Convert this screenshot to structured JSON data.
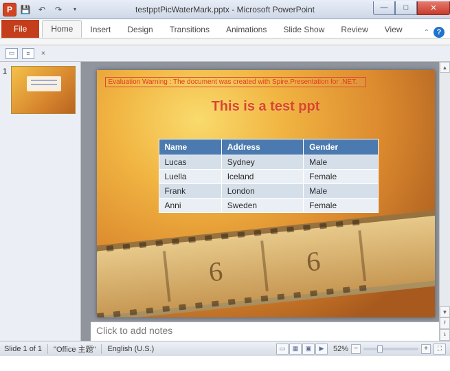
{
  "window": {
    "app_letter": "P",
    "title": "testpptPicWaterMark.pptx - Microsoft PowerPoint"
  },
  "ribbon": {
    "file": "File",
    "tabs": [
      "Home",
      "Insert",
      "Design",
      "Transitions",
      "Animations",
      "Slide Show",
      "Review",
      "View"
    ]
  },
  "thumbs": {
    "num1": "1"
  },
  "slide": {
    "warning": "Evaluation Warning : The document was created with Spire.Presentation for .NET.",
    "title": "This is  a test ppt",
    "film_digits": [
      "6",
      "6"
    ],
    "table": {
      "headers": [
        "Name",
        "Address",
        "Gender"
      ],
      "rows": [
        [
          "Lucas",
          "Sydney",
          "Male"
        ],
        [
          "Luella",
          "Iceland",
          "Female"
        ],
        [
          "Frank",
          "London",
          "Male"
        ],
        [
          "Anni",
          "Sweden",
          "Female"
        ]
      ]
    }
  },
  "notes": {
    "placeholder": "Click to add notes"
  },
  "status": {
    "slide": "Slide 1 of 1",
    "theme": "\"Office 主题\"",
    "lang": "English (U.S.)",
    "zoom": "52%"
  }
}
